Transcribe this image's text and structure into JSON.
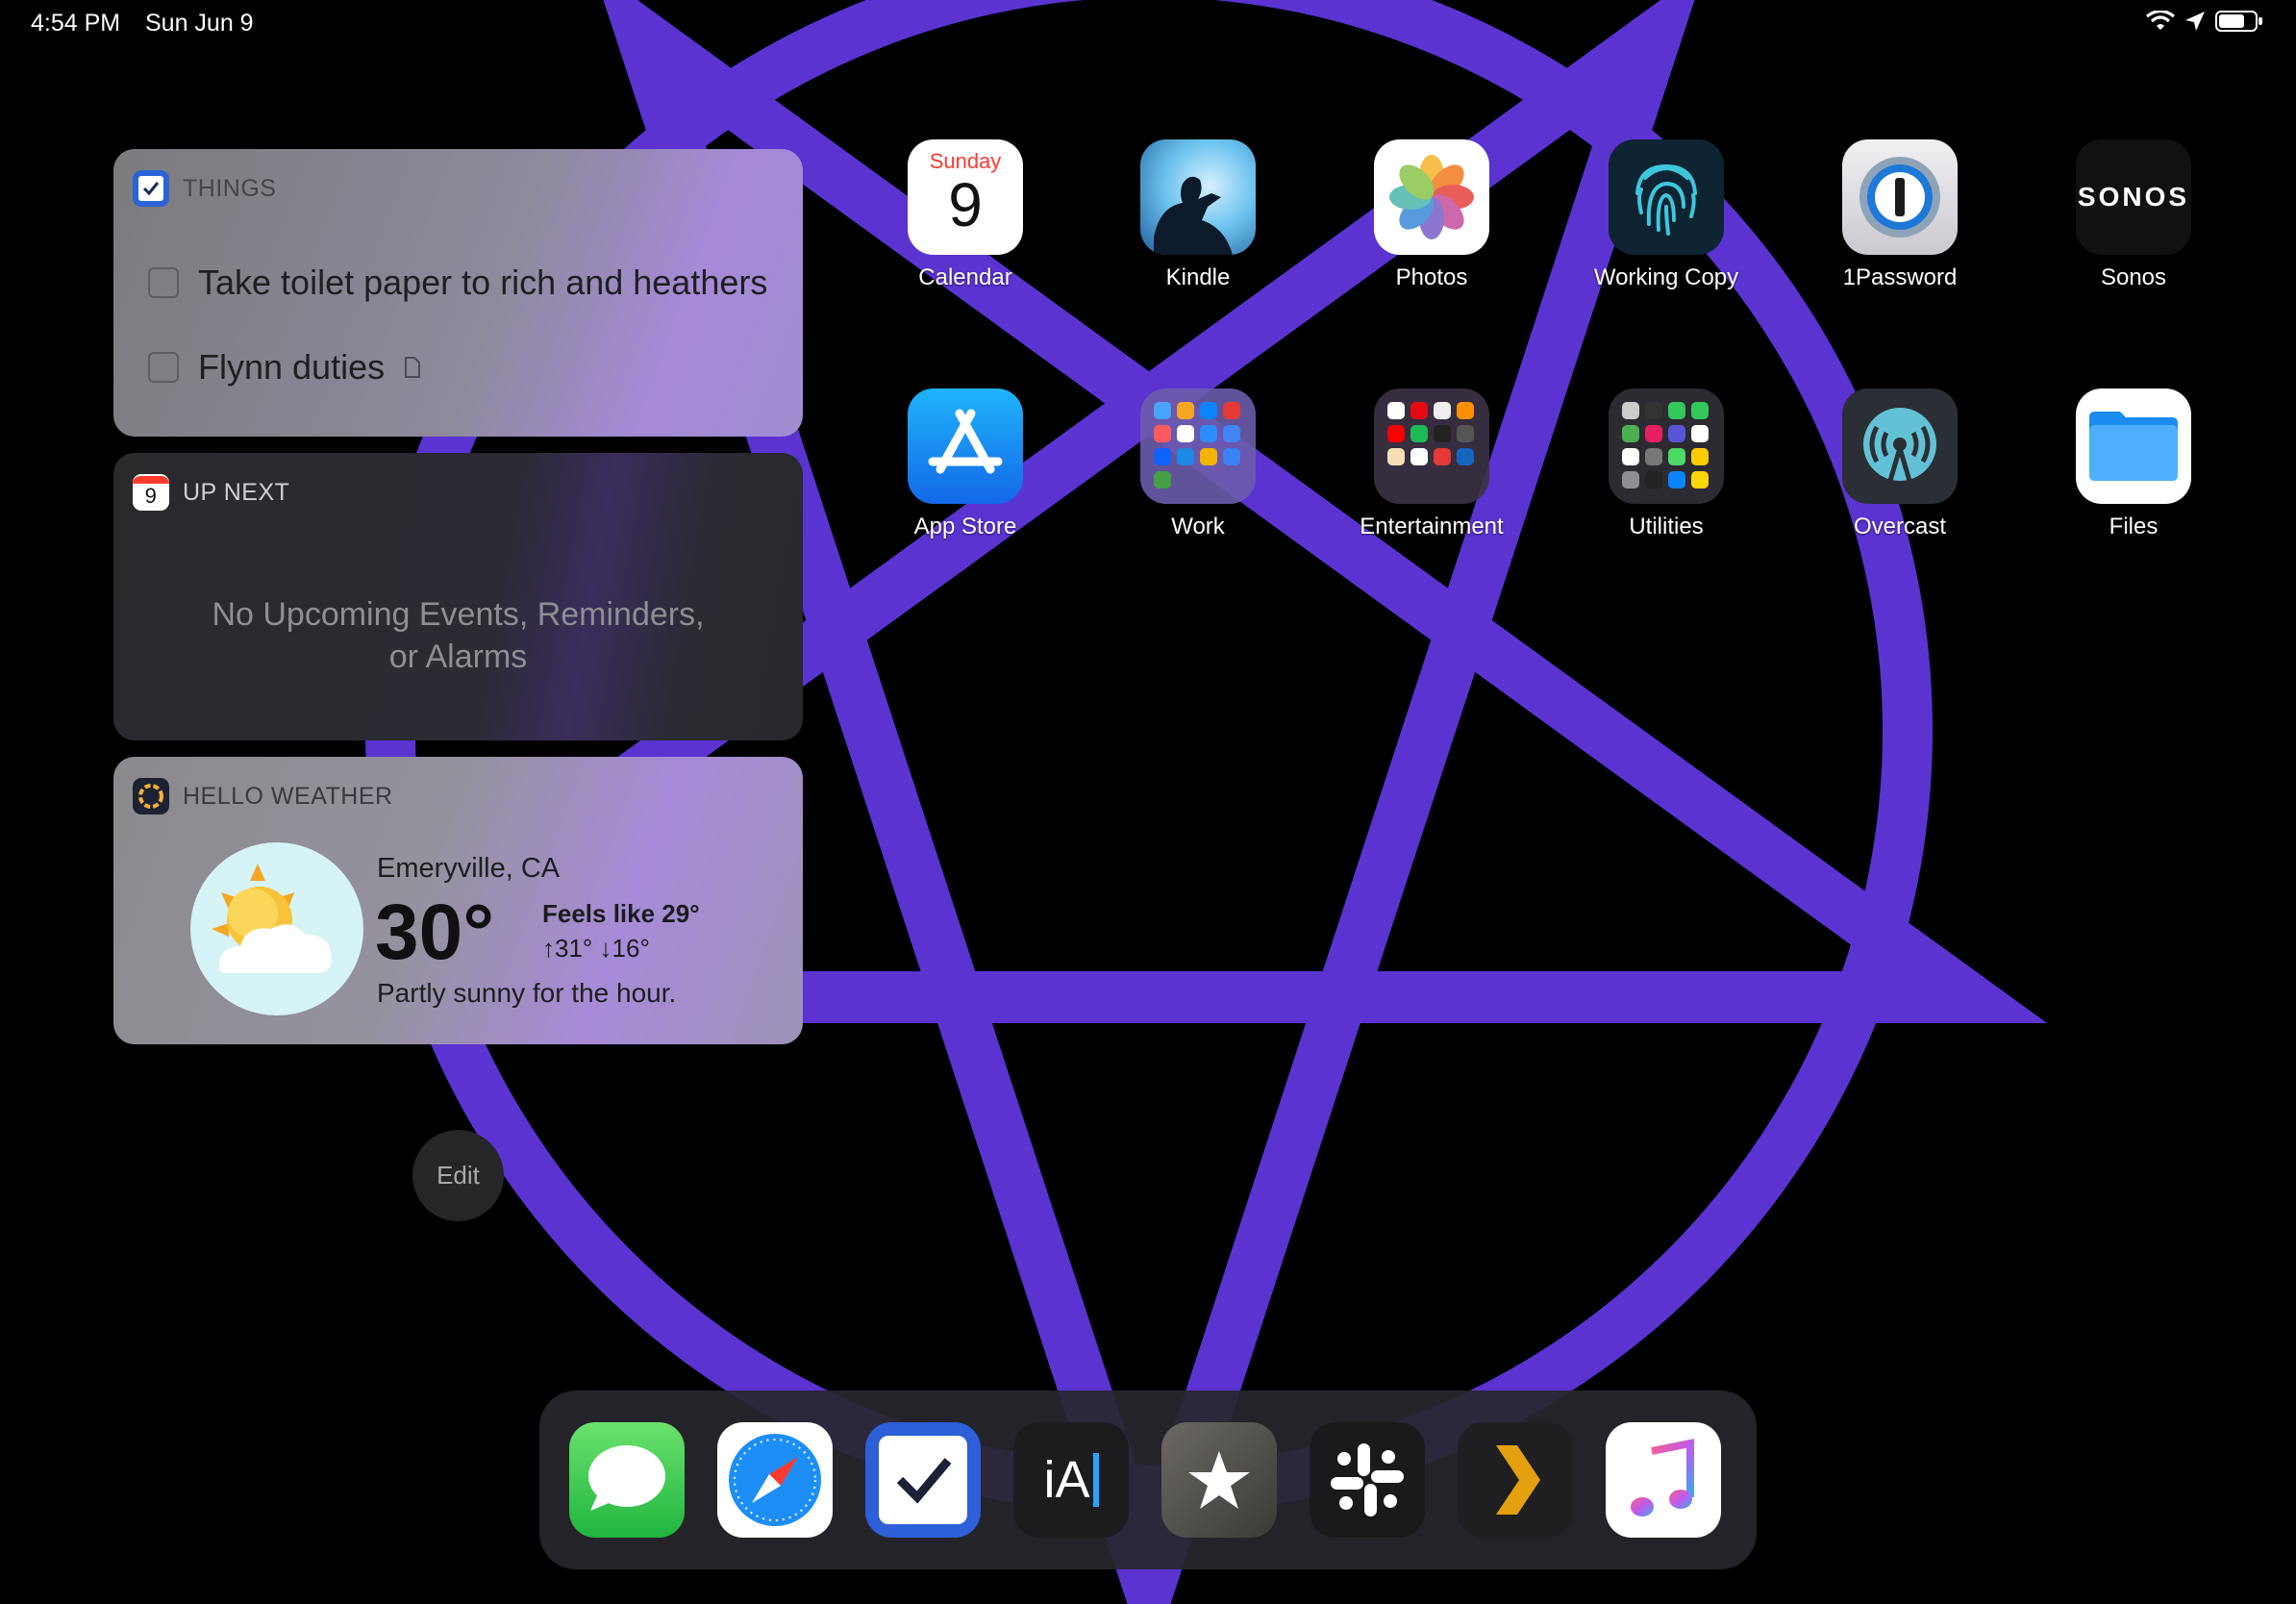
{
  "status_bar": {
    "time": "4:54 PM",
    "date": "Sun Jun 9",
    "icons": [
      "wifi-icon",
      "location-arrow-icon",
      "battery-icon"
    ]
  },
  "widgets": {
    "things": {
      "title": "THINGS",
      "items": [
        {
          "text": "Take toilet paper to rich and heathers",
          "checked": false
        },
        {
          "text": "Flynn duties",
          "checked": false,
          "has_note": true
        }
      ]
    },
    "up_next": {
      "title": "UP NEXT",
      "icon_day": "9",
      "empty_line1": "No Upcoming Events, Reminders,",
      "empty_line2": "or Alarms"
    },
    "weather": {
      "title": "HELLO WEATHER",
      "city": "Emeryville, CA",
      "temp": "30°",
      "feels_like": "Feels like 29°",
      "range": "↑31° ↓16°",
      "description": "Partly sunny for the hour."
    }
  },
  "edit_label": "Edit",
  "apps_row1": [
    {
      "label": "Calendar",
      "icon": "calendar-icon",
      "day_name": "Sunday",
      "day": "9"
    },
    {
      "label": "Kindle",
      "icon": "kindle-icon"
    },
    {
      "label": "Photos",
      "icon": "photos-icon"
    },
    {
      "label": "Working Copy",
      "icon": "working-copy-icon"
    },
    {
      "label": "1Password",
      "icon": "1password-icon"
    },
    {
      "label": "Sonos",
      "icon": "sonos-icon",
      "wordmark": "SONOS"
    }
  ],
  "apps_row2": [
    {
      "label": "App Store",
      "icon": "app-store-icon"
    },
    {
      "label": "Work",
      "icon": "folder-icon"
    },
    {
      "label": "Entertainment",
      "icon": "folder-icon"
    },
    {
      "label": "Utilities",
      "icon": "folder-icon"
    },
    {
      "label": "Overcast",
      "icon": "overcast-icon"
    },
    {
      "label": "Files",
      "icon": "files-icon"
    }
  ],
  "dock": [
    "messages-icon",
    "safari-icon",
    "things-icon",
    "ia-writer-icon",
    "reeder-icon",
    "slack-icon",
    "plex-icon",
    "music-icon"
  ],
  "dock_text": {
    "ia": "iA"
  },
  "colors": {
    "wallpaper_accent": "#5b33d1",
    "background": "#000000"
  }
}
